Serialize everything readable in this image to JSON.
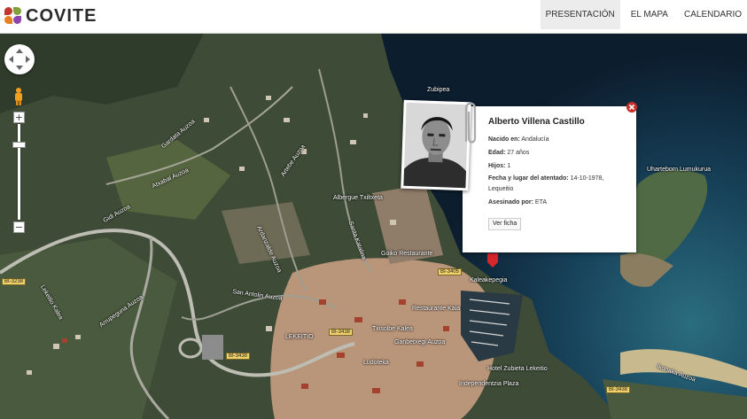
{
  "header": {
    "logo_text": "COVITE",
    "nav": [
      {
        "label": "PRESENTACIÓN",
        "active": true
      },
      {
        "label": "EL MAPA",
        "active": false
      },
      {
        "label": "CALENDARIO",
        "active": false
      }
    ]
  },
  "map": {
    "labels": {
      "zubipea": "Zubipea",
      "gardata": "Gardata Auzoa",
      "atxabal": "Atxabal Auzoa",
      "artebe": "Artebe Auzoa",
      "albergue": "Albergue Txiltxeta",
      "ardanzalde": "Ardanzalde Auzoa",
      "santa_katalina": "Santa Katalina",
      "gidi": "Gidi Auzoa",
      "san_antolin": "San Antolin Auzoa",
      "uharteborn": "Uharteborn Lumukurua",
      "lekeitio": "LEKEITIO",
      "ikonaka": "Ikonaka Auzoa",
      "restaurante_kaia": "Restaurante Kaia",
      "txisolbe": "Txisolbe Kalea",
      "independentzia": "Independentzia Plaza",
      "hotel": "Hotel Zubieta Lekeitio",
      "kaleakepegia": "Kaleakepegia",
      "goiko": "Goiko Restaurante",
      "ludoteka": "Ludoteka",
      "arropaguna": "Arrupeguna Auzoa",
      "lekeitio_k": "Lekeitio Kalea",
      "ganbetxegi": "Ganbetxegi Auzoa"
    },
    "shields": {
      "bi3238": "BI-3238",
      "bi3438a": "BI-3438",
      "bi3438b": "BI-3438",
      "bi3405": "BI-3405",
      "bi3438c": "BI-3438"
    }
  },
  "popup": {
    "name": "Alberto Villena Castillo",
    "born_label": "Nacido en:",
    "born": "Andalucía",
    "age_label": "Edad:",
    "age": "27 años",
    "children_label": "Hijos:",
    "children": "1",
    "date_place_label": "Fecha y lugar del atentado:",
    "date_place": "14-10-1978, Lequeitio",
    "killed_by_label": "Asesinado por:",
    "killed_by": "ETA",
    "button": "Ver ficha"
  },
  "colors": {
    "sea": "#0f2336",
    "land": "#3e4c37",
    "town": "#b9957a",
    "close": "#c9302c"
  }
}
